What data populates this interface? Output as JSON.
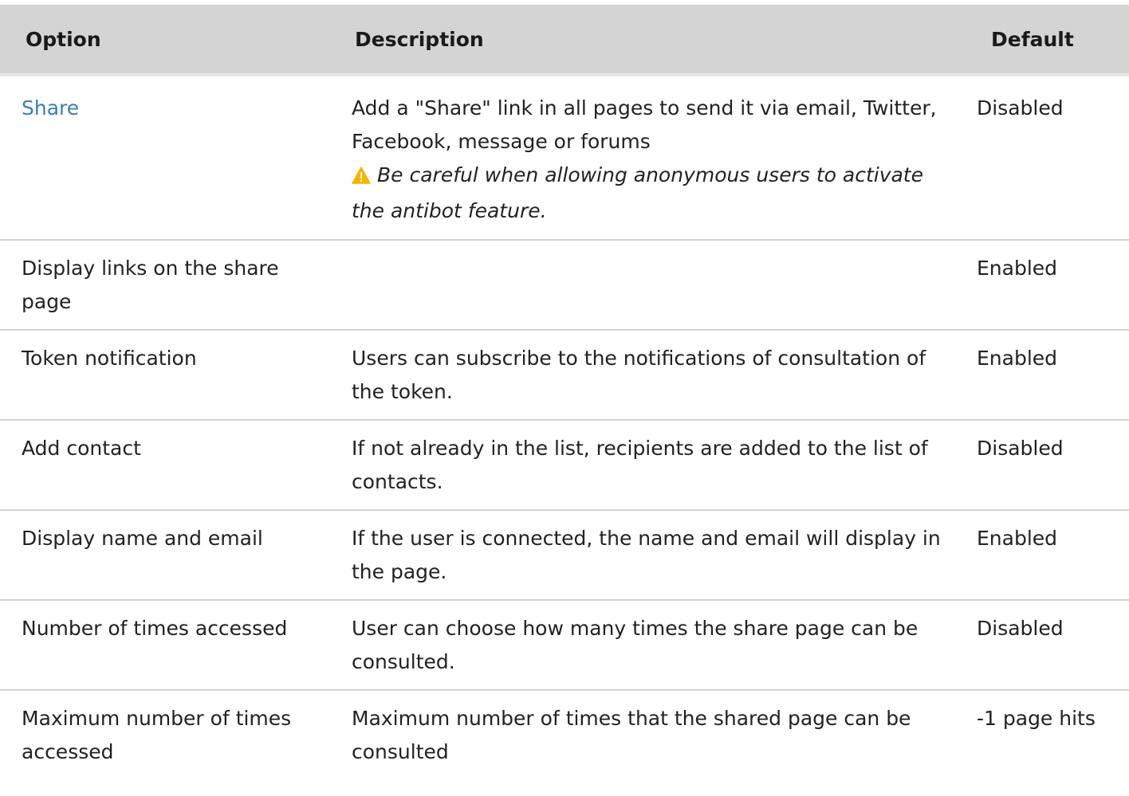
{
  "table": {
    "headers": {
      "option": "Option",
      "description": "Description",
      "default": "Default"
    },
    "rows": [
      {
        "option": "Share",
        "option_is_link": true,
        "description": "Add a \"Share\" link in all pages to send it via email, Twitter, Facebook, message or forums",
        "warning": "Be careful when allowing anonymous users to activate the antibot feature.",
        "default": "Disabled"
      },
      {
        "option": "Display links on the share page",
        "description": "",
        "default": "Enabled"
      },
      {
        "option": "Token notification",
        "description": "Users can subscribe to the notifications of consultation of the token.",
        "default": "Enabled"
      },
      {
        "option": "Add contact",
        "description": "If not already in the list, recipients are added to the list of contacts.",
        "default": "Disabled"
      },
      {
        "option": "Display name and email",
        "description": "If the user is connected, the name and email will display in the page.",
        "default": "Enabled"
      },
      {
        "option": "Number of times accessed",
        "description": "User can choose how many times the share page can be consulted.",
        "default": "Disabled"
      },
      {
        "option": "Maximum number of times accessed",
        "description": "Maximum number of times that the shared page can be consulted",
        "default": "-1 page hits"
      }
    ]
  },
  "icons": {
    "warning": "warning-icon"
  },
  "colors": {
    "header_bg": "#d4d4d4",
    "link": "#3a7dba",
    "warning_icon": "#f5b400",
    "row_border": "#d2d2d2"
  }
}
